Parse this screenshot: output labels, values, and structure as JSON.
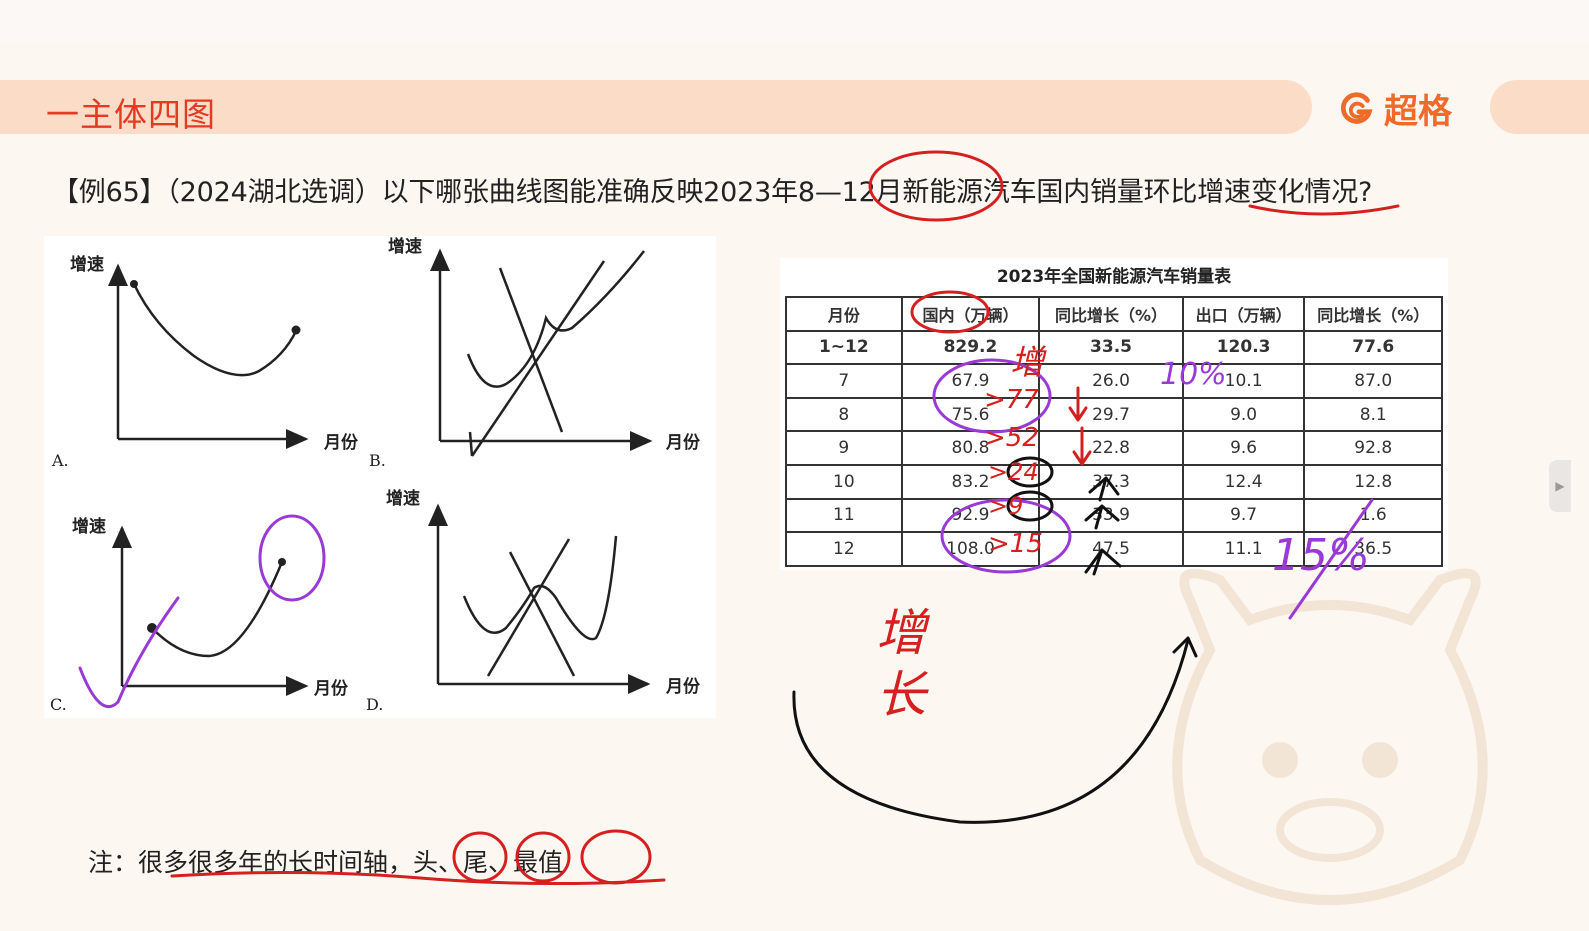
{
  "header": {
    "title": "一主体四图",
    "brand_name": "超格",
    "brand_logo_icon": "g-swirl-logo-icon",
    "accent_color": "#e23b25",
    "band_color": "#fbdcc7"
  },
  "question": {
    "text": "【例65】（2024湖北选调）以下哪张曲线图能准确反映2023年8—12月新能源汽车国内销量环比增速变化情况?"
  },
  "options": {
    "y_label": "增速",
    "x_label": "月份",
    "a_label": "A.",
    "b_label": "B.",
    "c_label": "C.",
    "d_label": "D."
  },
  "sales_table": {
    "title": "2023年全国新能源汽车销量表",
    "headers": [
      "月份",
      "国内（万辆）",
      "同比增长（%）",
      "出口（万辆）",
      "同比增长（%）"
    ],
    "rows": [
      [
        "1~12",
        "829.2",
        "33.5",
        "120.3",
        "77.6"
      ],
      [
        "7",
        "67.9",
        "26.0",
        "10.1",
        "87.0"
      ],
      [
        "8",
        "75.6",
        "29.7",
        "9.0",
        "8.1"
      ],
      [
        "9",
        "80.8",
        "22.8",
        "9.6",
        "92.8"
      ],
      [
        "10",
        "83.2",
        "37.3",
        "12.4",
        "12.8"
      ],
      [
        "11",
        "92.9",
        "33.9",
        "9.7",
        "1.6"
      ],
      [
        "12",
        "108.0",
        "47.5",
        "11.1",
        "36.5"
      ]
    ]
  },
  "annotations": {
    "domestic_increase": "增",
    "diff_7_8": ">77",
    "diff_8_9": ">52",
    "diff_9_10": ">24",
    "diff_10_11": ">9",
    "diff_11_12": ">15",
    "export_mark_top": "10%",
    "export_mark_bottom": "15%",
    "bottom_note": "增",
    "bottom_note_2": "长"
  },
  "note": {
    "text": "注：很多很多年的长时间轴，头、尾、最值"
  }
}
